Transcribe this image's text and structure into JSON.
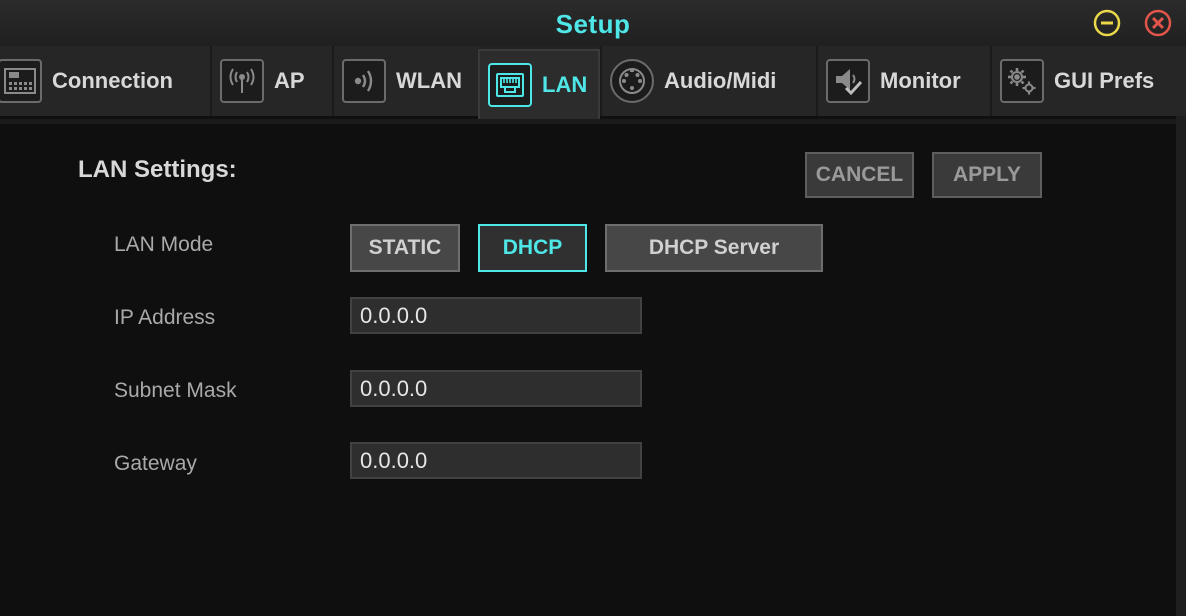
{
  "window": {
    "title": "Setup",
    "accent": "#4ee6e6"
  },
  "tabs": [
    {
      "label": "Connection",
      "icon": "mixer-icon"
    },
    {
      "label": "AP",
      "icon": "antenna-icon"
    },
    {
      "label": "WLAN",
      "icon": "wireless-icon"
    },
    {
      "label": "LAN",
      "icon": "ethernet-icon",
      "active": true
    },
    {
      "label": "Audio/Midi",
      "icon": "midi-icon"
    },
    {
      "label": "Monitor",
      "icon": "speaker-check-icon"
    },
    {
      "label": "GUI Prefs",
      "icon": "gears-icon"
    }
  ],
  "lan": {
    "heading": "LAN Settings:",
    "cancel_label": "CANCEL",
    "apply_label": "APPLY",
    "mode_label": "LAN Mode",
    "modes": {
      "static": "STATIC",
      "dhcp": "DHCP",
      "dhcp_server": "DHCP Server"
    },
    "selected_mode": "DHCP",
    "ip_label": "IP Address",
    "ip_value": "0.0.0.0",
    "subnet_label": "Subnet Mask",
    "subnet_value": "0.0.0.0",
    "gateway_label": "Gateway",
    "gateway_value": "0.0.0.0"
  }
}
